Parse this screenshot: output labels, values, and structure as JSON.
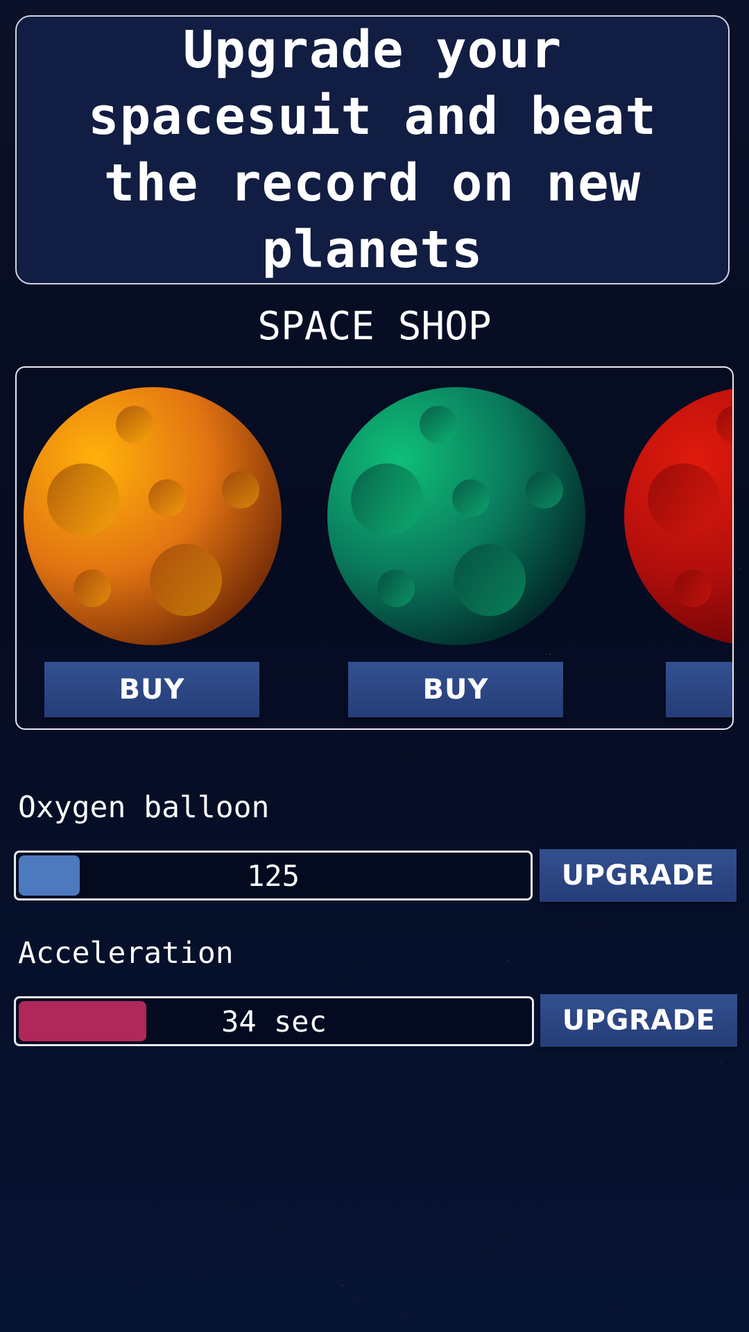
{
  "banner": {
    "text": "Upgrade your spacesuit and beat the record on new planets"
  },
  "shop": {
    "title": "SPACE SHOP",
    "items": [
      {
        "name": "orange-planet",
        "colors": {
          "light": "#ffb10a",
          "mid": "#e27412",
          "dark": "#7a2f07"
        },
        "buy_label": "BUY"
      },
      {
        "name": "green-planet",
        "colors": {
          "light": "#0fbf78",
          "mid": "#0a7a5c",
          "dark": "#022b2b"
        },
        "buy_label": "BUY"
      },
      {
        "name": "red-planet",
        "colors": {
          "light": "#e01a0c",
          "mid": "#b30f0c",
          "dark": "#6a0306"
        },
        "buy_label": ""
      }
    ]
  },
  "stats": [
    {
      "label": "Oxygen balloon",
      "value": "125",
      "fill_fraction": 0.12,
      "fill_color": "#4d79bf",
      "upgrade_label": "UPGRADE"
    },
    {
      "label": "Acceleration",
      "value": "34 sec",
      "fill_fraction": 0.25,
      "fill_color": "#b0275a",
      "upgrade_label": "UPGRADE"
    }
  ],
  "colors": {
    "background": "#050b20",
    "button": "#2d4785",
    "banner": "#111d42"
  }
}
